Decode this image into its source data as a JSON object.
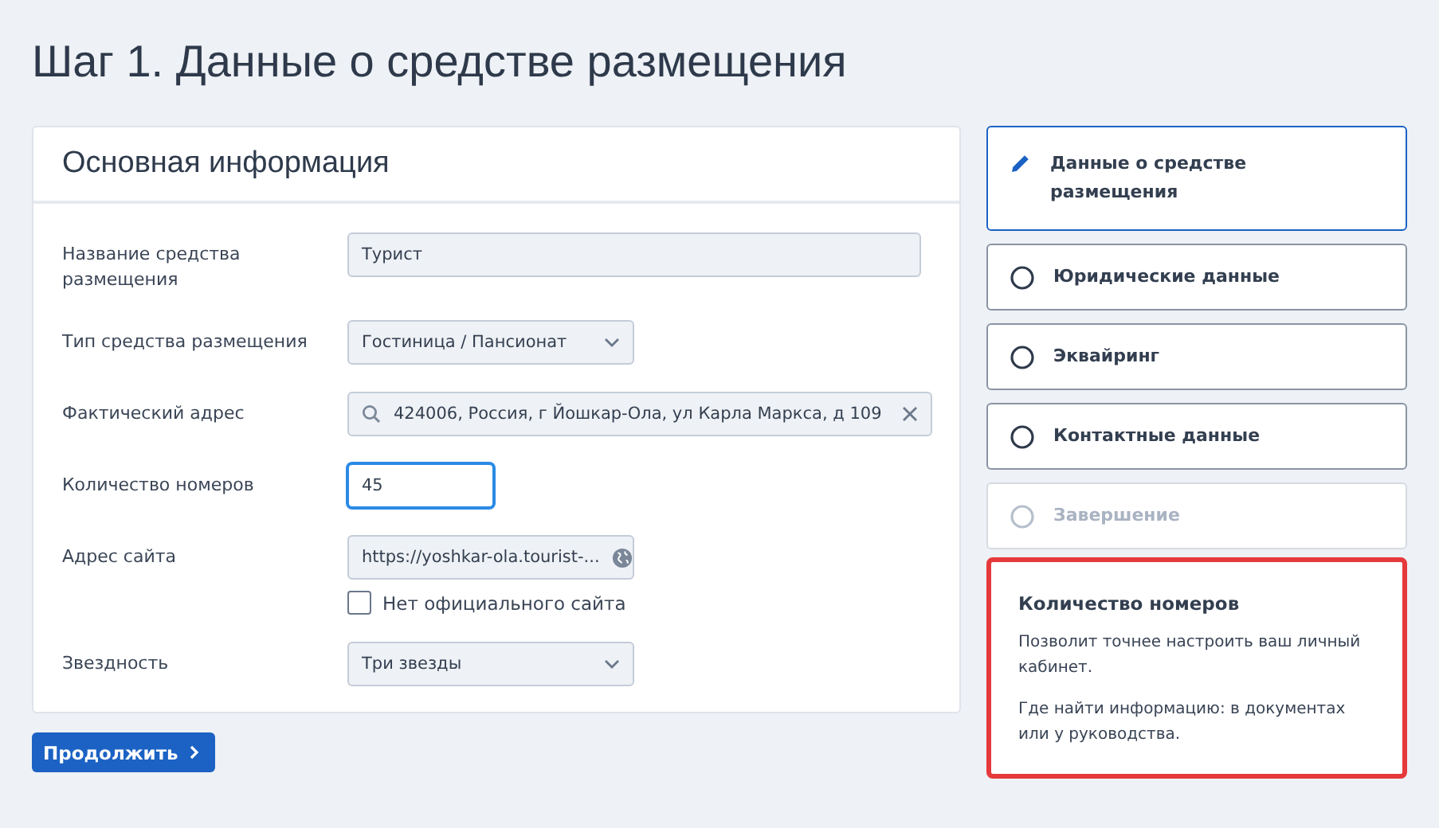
{
  "title": "Шаг 1. Данные о средстве размещения",
  "card": {
    "title": "Основная информация",
    "fields": [
      {
        "kind": "text",
        "label": "Название средства размещения",
        "value": "Турист",
        "focused": false
      },
      {
        "kind": "select",
        "label": "Тип средства размещения",
        "value": "Гостиница / Пансионат",
        "focused": false
      },
      {
        "kind": "address",
        "label": "Фактический адрес",
        "value": "424006, Россия, г Йошкар-Ола, ул Карла Маркса, д 109",
        "focused": false
      },
      {
        "kind": "number",
        "label": "Количество номеров",
        "value": "45",
        "focused": true
      },
      {
        "kind": "url",
        "label": "Адрес сайта",
        "value": "https://yoshkar-ola.tourist-...",
        "focused": false,
        "checkbox": {
          "label": "Нет официального сайта",
          "checked": false
        }
      },
      {
        "kind": "select",
        "label": "Звездность",
        "value": "Три звезды",
        "focused": false
      }
    ]
  },
  "continue_button": "Продолжить",
  "steps": [
    {
      "label": "Данные о средстве размещения",
      "selected": true,
      "disabled": false
    },
    {
      "label": "Юридические данные",
      "selected": false,
      "disabled": false
    },
    {
      "label": "Эквайринг",
      "selected": false,
      "disabled": false
    },
    {
      "label": "Контактные данные",
      "selected": false,
      "disabled": false
    },
    {
      "label": "Завершение",
      "selected": false,
      "disabled": true
    }
  ],
  "hint": {
    "title": "Количество номеров",
    "paragraphs": [
      "Позволит точнее настроить ваш личный кабинет.",
      "Где найти информацию: в документах или у руководства."
    ]
  }
}
